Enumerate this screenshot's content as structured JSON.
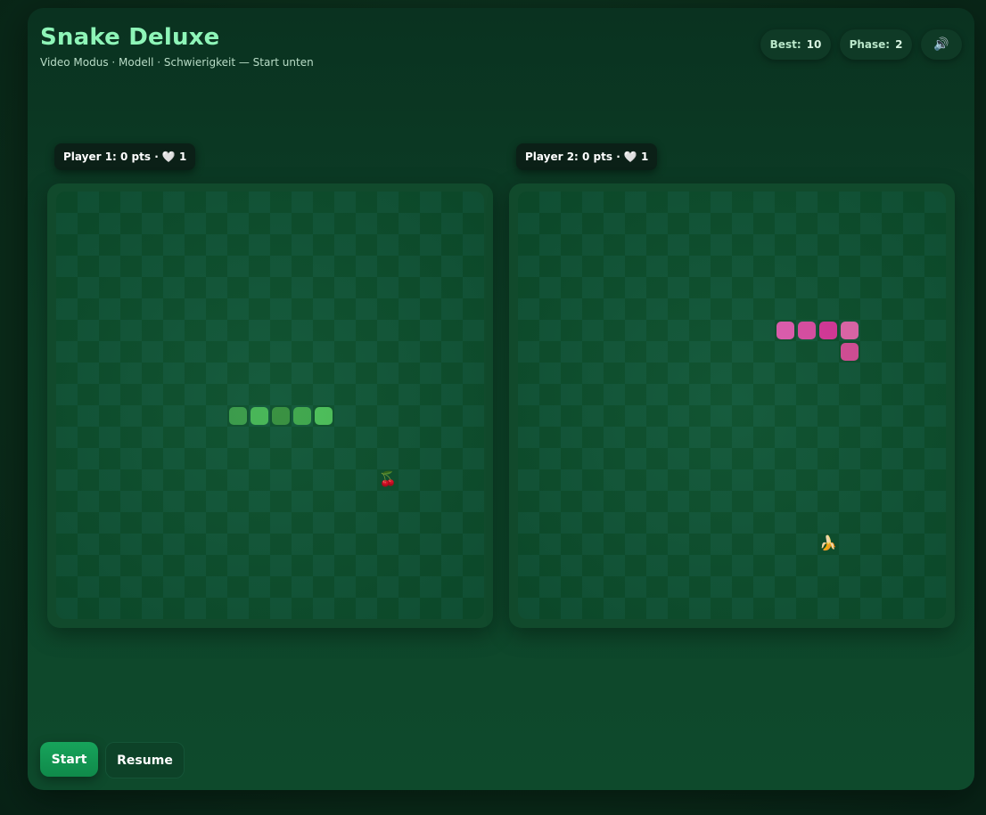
{
  "header": {
    "title": "Snake Deluxe",
    "subtitle": "Video Modus · Modell · Schwierigkeit — Start unten"
  },
  "stats": {
    "best_label": "Best:",
    "best_value": "10",
    "phase_label": "Phase:",
    "phase_value": "2",
    "sound_icon": "🔊"
  },
  "players": [
    {
      "label": "Player 1: 0 pts · 🤍 1",
      "snake_color": "#3fae4f",
      "food": "🍒"
    },
    {
      "label": "Player 2: 0 pts · 🤍 1",
      "snake_color": "#d94f9e",
      "food": "🍌"
    }
  ],
  "controls": {
    "start_label": "Start",
    "resume_label": "Resume"
  },
  "colors": {
    "accent": "#8ef5b8",
    "start_button": "#12995a"
  }
}
